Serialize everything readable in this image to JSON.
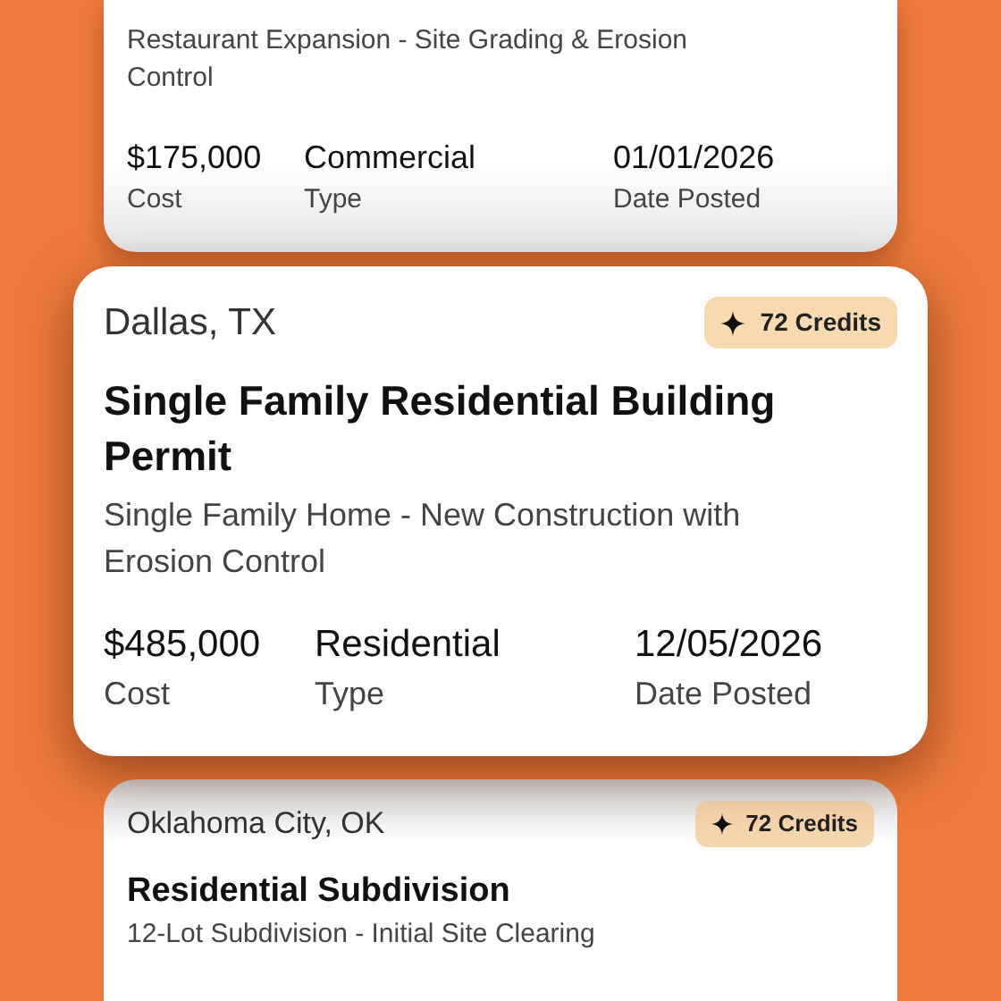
{
  "cards": [
    {
      "selected": false,
      "description": "Restaurant Expansion - Site Grading & Erosion Control",
      "stats": [
        {
          "value": "$175,000",
          "label": "Cost"
        },
        {
          "value": "Commercial",
          "label": "Type"
        },
        {
          "value": "01/01/2026",
          "label": "Date Posted"
        }
      ]
    },
    {
      "selected": true,
      "location": "Dallas, TX",
      "credits": "72 Credits",
      "title": "Single Family Residential Building Permit",
      "description": "Single Family Home - New Construction with Erosion Control",
      "stats": [
        {
          "value": "$485,000",
          "label": "Cost"
        },
        {
          "value": "Residential",
          "label": "Type"
        },
        {
          "value": "12/05/2026",
          "label": "Date Posted"
        }
      ]
    },
    {
      "selected": false,
      "location": "Oklahoma City, OK",
      "credits": "72 Credits",
      "title": "Residential Subdivision",
      "description": "12-Lot Subdivision - Initial Site Clearing"
    }
  ]
}
